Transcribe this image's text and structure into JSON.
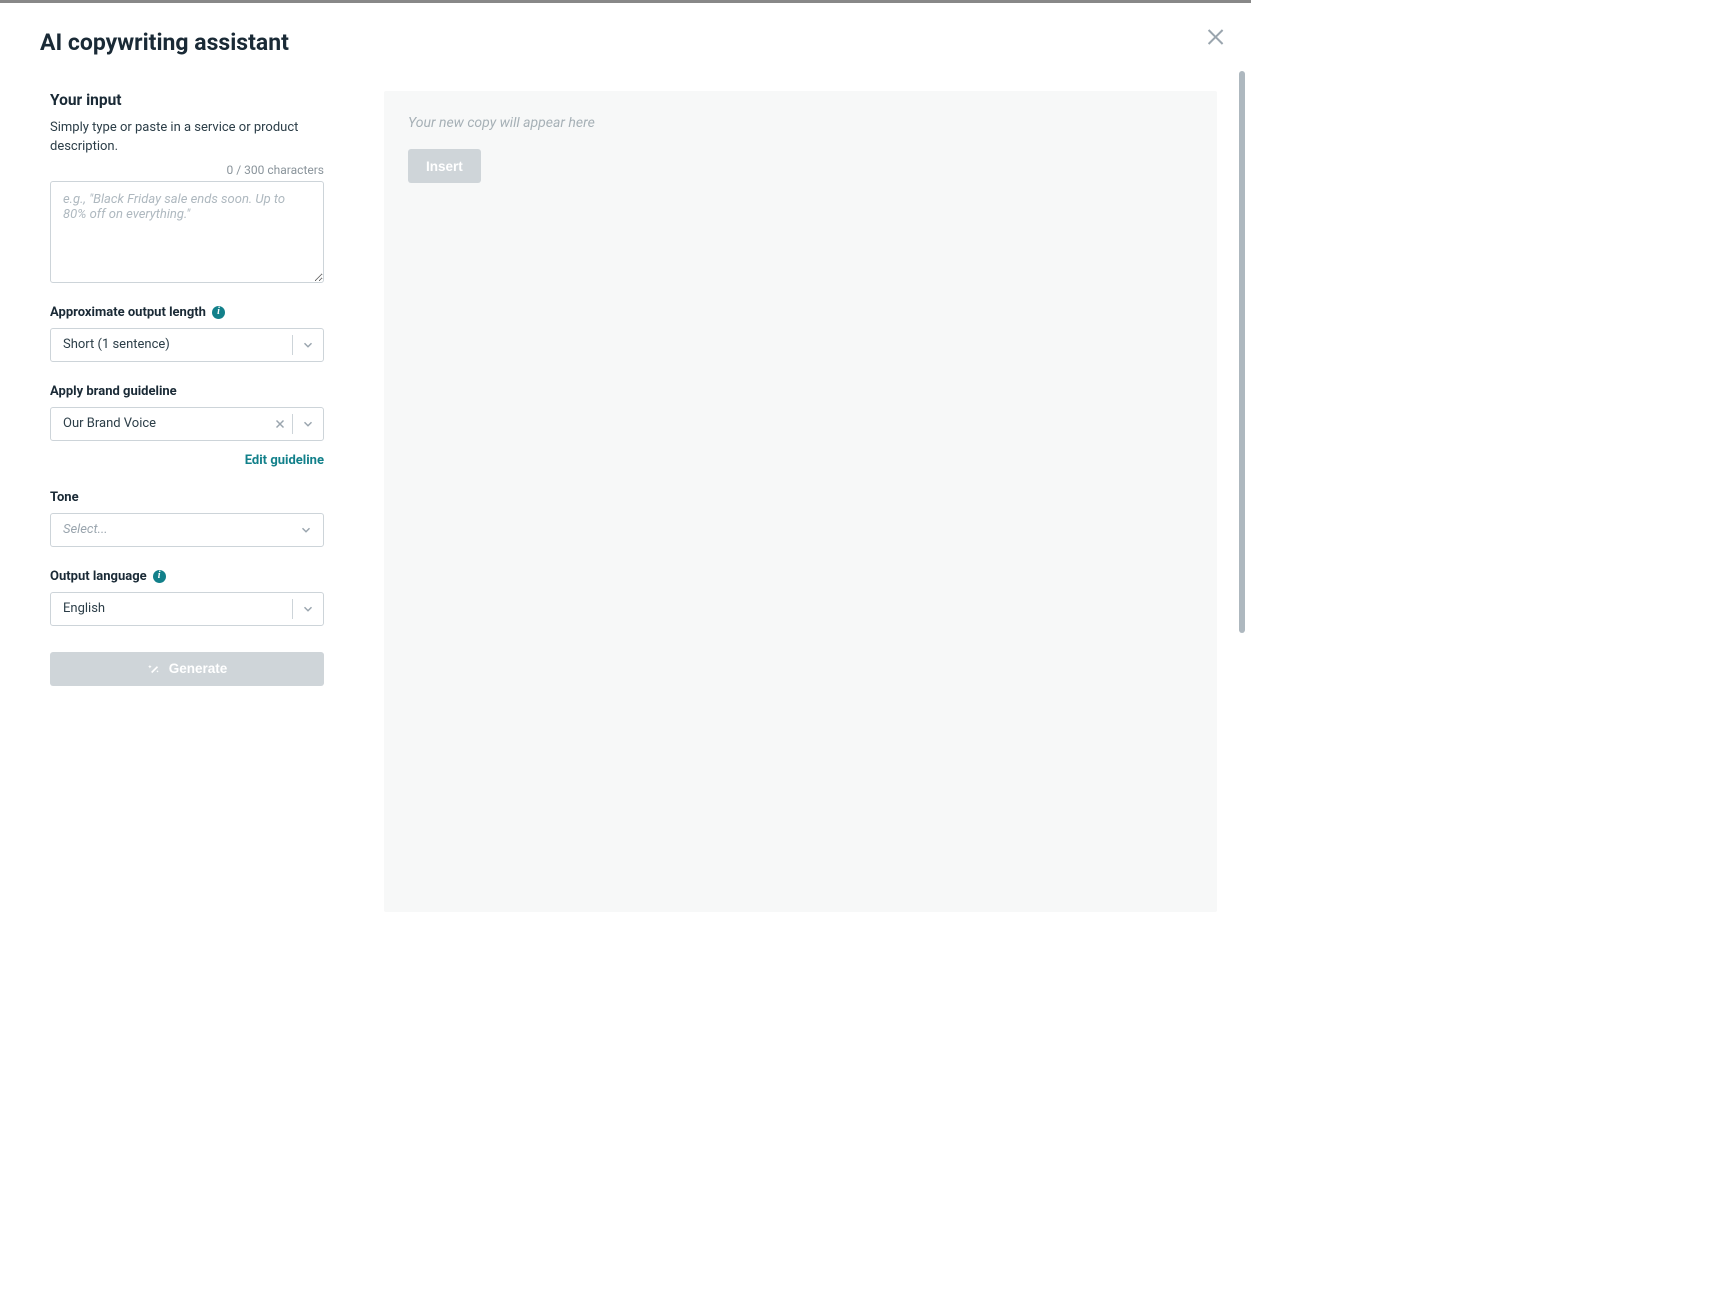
{
  "modal": {
    "title": "AI copywriting assistant"
  },
  "input": {
    "heading": "Your input",
    "description": "Simply type or paste in a service or product description.",
    "char_counter": "0 / 300 characters",
    "placeholder": "e.g., \"Black Friday sale ends soon. Up to 80% off on everything.\""
  },
  "fields": {
    "length": {
      "label": "Approximate output length",
      "value": "Short (1 sentence)"
    },
    "brand": {
      "label": "Apply brand guideline",
      "value": "Our Brand Voice",
      "edit_link": "Edit guideline"
    },
    "tone": {
      "label": "Tone",
      "placeholder": "Select..."
    },
    "language": {
      "label": "Output language",
      "value": "English"
    }
  },
  "buttons": {
    "generate": "Generate",
    "insert": "Insert"
  },
  "output": {
    "placeholder": "Your new copy will appear here"
  }
}
